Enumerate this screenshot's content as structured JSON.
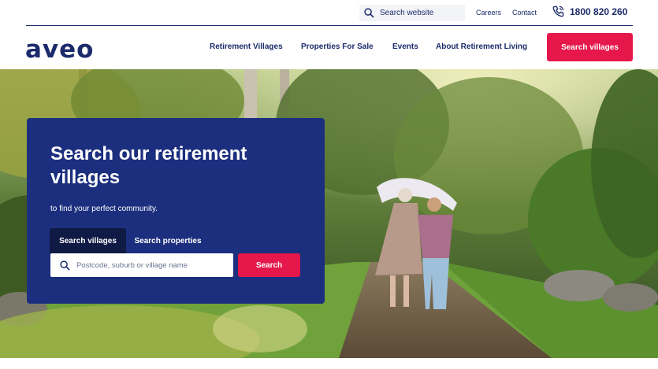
{
  "topbar": {
    "search_label": "Search website",
    "links": [
      "Careers",
      "Contact"
    ],
    "phone": "1800 820 260"
  },
  "nav": {
    "logo": "aveo",
    "items": [
      "Retirement Villages",
      "Properties For Sale",
      "Events",
      "About Retirement Living"
    ],
    "cta": "Search villages"
  },
  "hero": {
    "heading": "Search our retirement villages",
    "subheading": "to find your perfect community.",
    "tabs": [
      "Search villages",
      "Search properties"
    ],
    "search_placeholder": "Postcode, suburb or village name",
    "search_button": "Search"
  },
  "colors": {
    "navy": "#1c2b6b",
    "card": "#1c2f7e",
    "accent": "#e5174b"
  }
}
